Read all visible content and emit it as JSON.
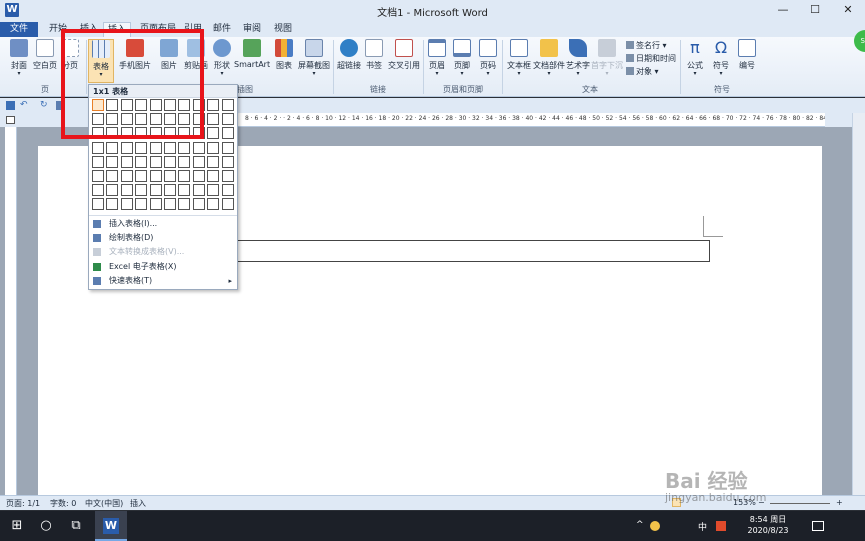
{
  "window": {
    "title": "文档1 - Microsoft Word",
    "app_icon": "W",
    "minimize": "—",
    "maximize": "☐",
    "close": "✕"
  },
  "tabs": [
    "文件",
    "开始",
    "插入",
    "页面布局",
    "引用",
    "邮件",
    "审阅",
    "视图"
  ],
  "ribbon": {
    "buttons": [
      {
        "label": "封面",
        "icon": "cover-page-icon"
      },
      {
        "label": "空白页",
        "icon": "blank-page-icon"
      },
      {
        "label": "分页",
        "icon": "page-break-icon"
      },
      {
        "label": "表格",
        "icon": "table-icon"
      },
      {
        "label": "手机图片",
        "icon": "phone-picture-icon"
      },
      {
        "label": "图片",
        "icon": "picture-icon"
      },
      {
        "label": "剪贴画",
        "icon": "clipart-icon"
      },
      {
        "label": "形状",
        "icon": "shapes-icon"
      },
      {
        "label": "SmartArt",
        "icon": "smartart-icon"
      },
      {
        "label": "图表",
        "icon": "chart-icon"
      },
      {
        "label": "屏幕截图",
        "icon": "screenshot-icon"
      },
      {
        "label": "超链接",
        "icon": "hyperlink-icon"
      },
      {
        "label": "书签",
        "icon": "bookmark-icon"
      },
      {
        "label": "交叉引用",
        "icon": "cross-reference-icon"
      },
      {
        "label": "页眉",
        "icon": "header-icon"
      },
      {
        "label": "页脚",
        "icon": "footer-icon"
      },
      {
        "label": "页码",
        "icon": "page-number-icon"
      },
      {
        "label": "文本框",
        "icon": "textbox-icon"
      },
      {
        "label": "文档部件",
        "icon": "quick-parts-icon"
      },
      {
        "label": "艺术字",
        "icon": "wordart-icon"
      },
      {
        "label": "首字下沉",
        "icon": "drop-cap-icon"
      },
      {
        "label": "公式",
        "icon": "equation-icon"
      },
      {
        "label": "符号",
        "icon": "symbol-icon"
      },
      {
        "label": "编号",
        "icon": "number-icon"
      }
    ],
    "small_items": [
      "签名行 ▾",
      "日期和时间",
      "对象 ▾"
    ],
    "groups": [
      "页",
      "插图",
      "链接",
      "页眉和页脚",
      "文本",
      "符号"
    ]
  },
  "ruler": {
    "text": "8 · 6 · 4 · 2 · · 2 · 4 · 6 · 8 · 10 · 12 · 14 · 16 · 18 · 20 · 22 · 24 · 26 · 28 · 30 · 32 · 34 · 36 · 38 · 40 · 42 · 44 · 46 · 48 · 50 · 52 · 54 · 56 · 58 · 60 · 62 · 64 · 66 · 68 · 70 · 72 · 74 · 76 · 78 · 80 · 82 · 84 · 86 · 88"
  },
  "table_dropdown": {
    "header": "1x1 表格",
    "grid_cols": 10,
    "grid_rows": 8,
    "items": [
      {
        "label": "插入表格(I)...",
        "enabled": true,
        "submenu": ""
      },
      {
        "label": "绘制表格(D)",
        "enabled": true,
        "submenu": ""
      },
      {
        "label": "文本转换成表格(V)...",
        "enabled": false,
        "submenu": ""
      },
      {
        "label": "Excel 电子表格(X)",
        "enabled": true,
        "submenu": ""
      },
      {
        "label": "快速表格(T)",
        "enabled": true,
        "submenu": "▸"
      }
    ]
  },
  "status_bar": {
    "page": "页面: 1/1",
    "words": "字数: 0",
    "language": "中文(中国)",
    "insert_mode": "插入",
    "zoom": "153%",
    "zoom_minus": "−",
    "zoom_plus": "+"
  },
  "taskbar": {
    "start": "⊞",
    "search": "○",
    "task_view": "⧉",
    "tray_ime": "中",
    "time": "8:54 周日",
    "date": "2020/8/23"
  },
  "watermark": {
    "brand": "Bai 经验",
    "url": "jingyan.baidu.com"
  },
  "colors": {
    "highlight": "#e8141a",
    "file_tab": "#2a5caa",
    "ribbon_bg": "#dfe9f5"
  }
}
